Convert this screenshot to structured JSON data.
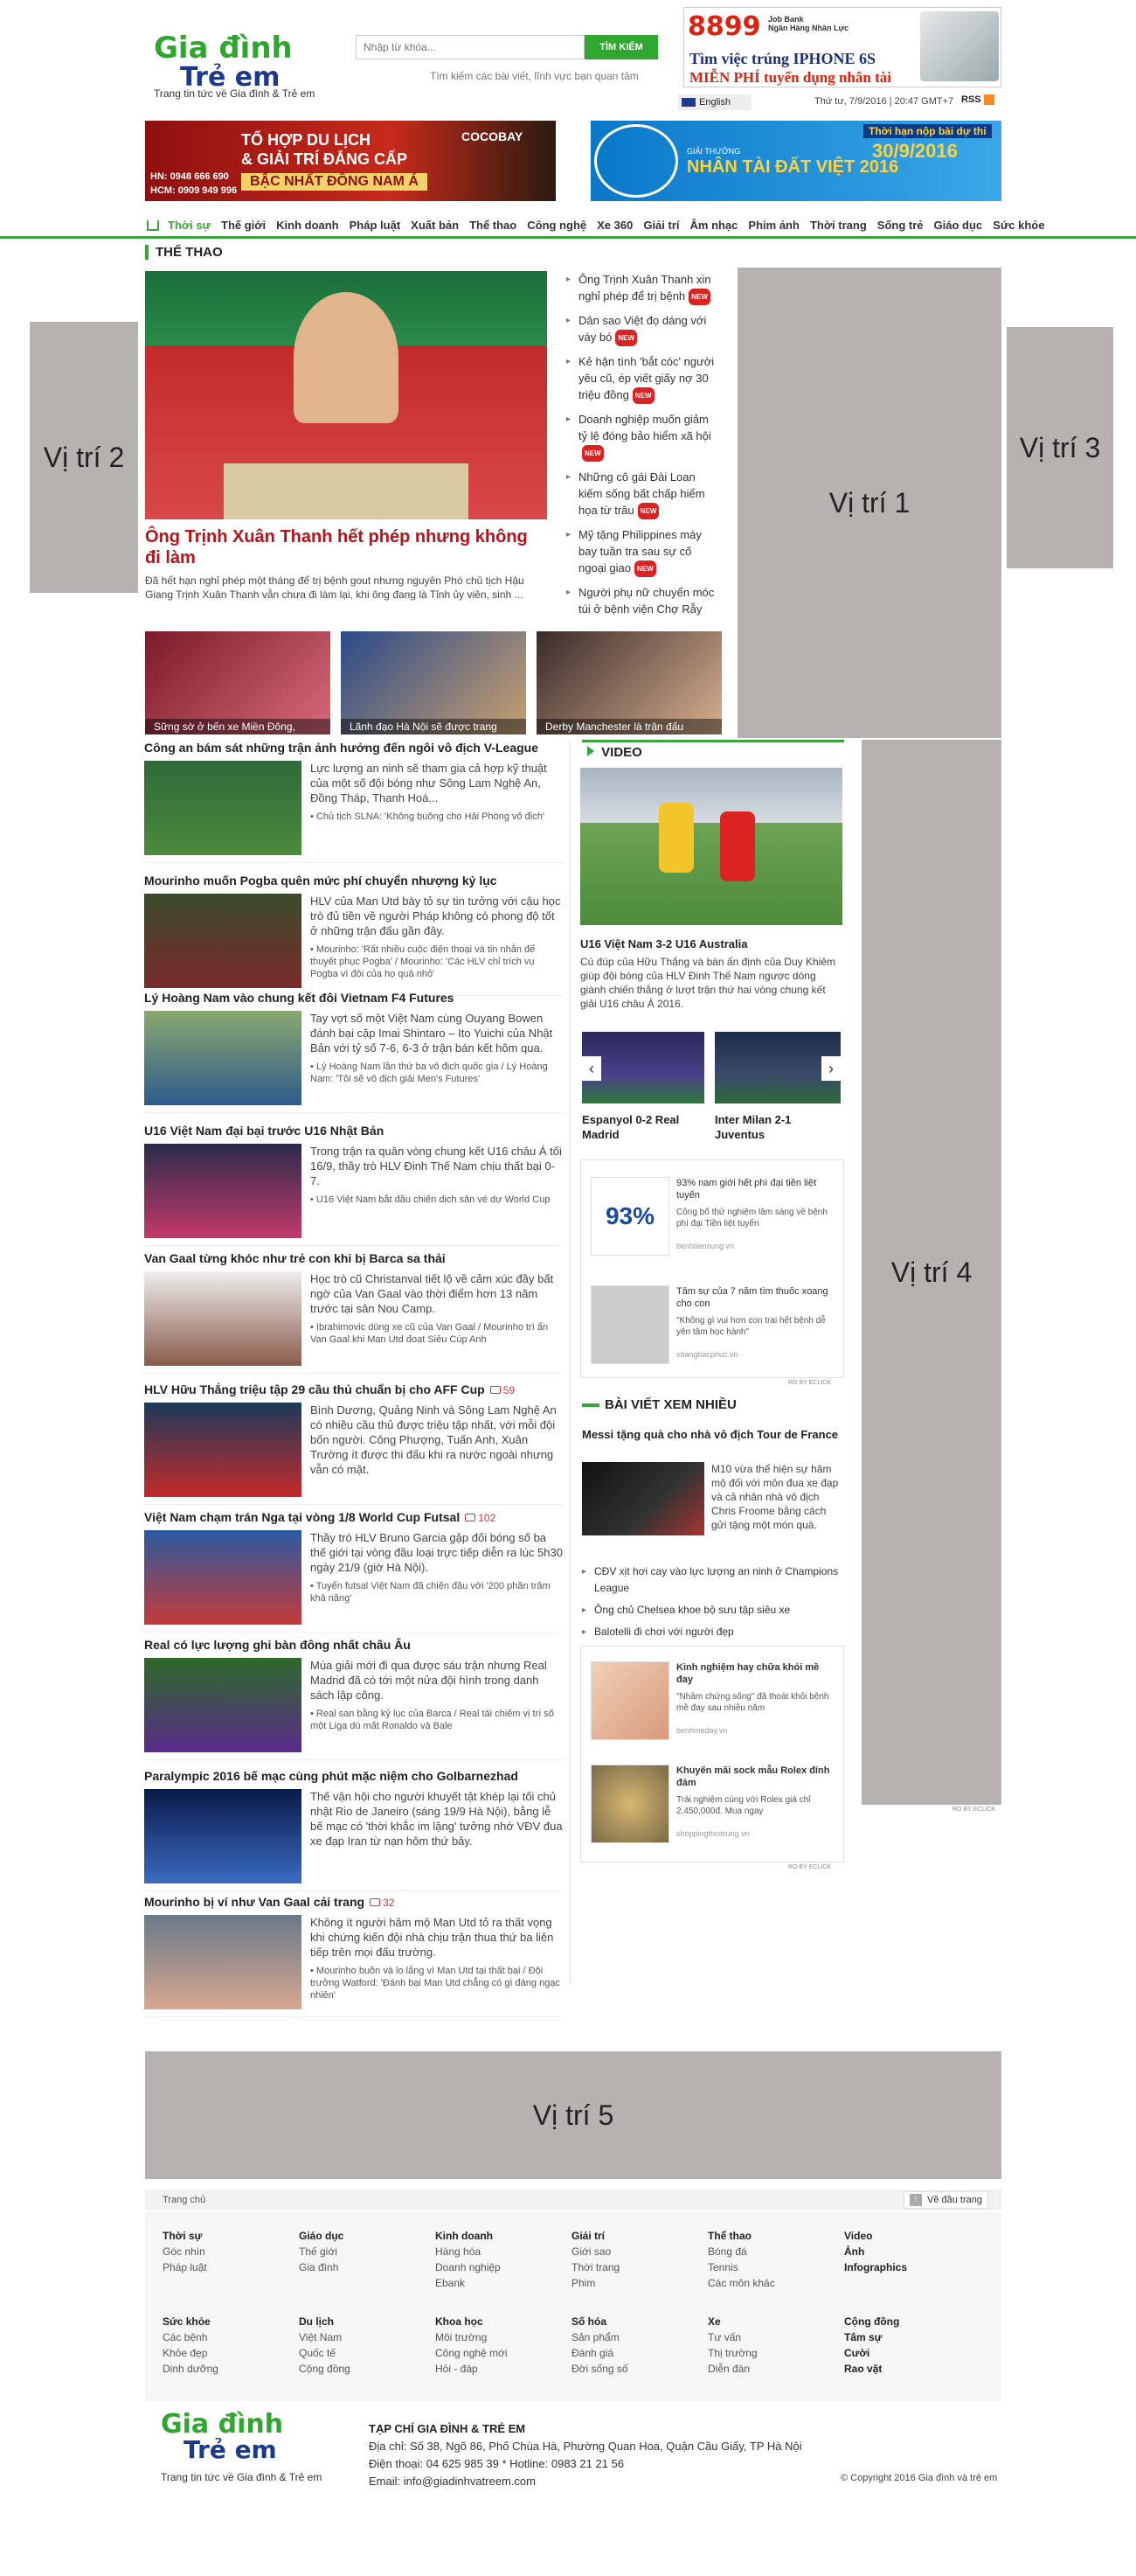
{
  "header": {
    "logo_line1": "Gia đình",
    "logo_line2": "Trẻ em",
    "tagline": "Trang tin tức về Gia đình & Trẻ em",
    "search_placeholder": "Nhập từ khóa...",
    "search_button": "TÌM KIẾM",
    "search_hint": "Tìm kiếm các bài viết, lĩnh vực bạn quan tâm",
    "lang": "English",
    "datetime": "Thứ tư, 7/9/2016 | 20:47 GMT+7",
    "rss": "RSS"
  },
  "banners": {
    "top_ad_num": "8899",
    "top_ad_bank": "Job Bank\nNgân Hàng Nhân Lực",
    "top_ad_line1": "Tìm việc trúng IPHONE 6S",
    "top_ad_line2": "MIỄN PHÍ tuyển dụng nhân tài",
    "left_ad_l1": "TỔ HỢP DU LỊCH",
    "left_ad_l2": "& GIẢI TRÍ ĐẲNG CẤP",
    "left_ad_l3": "BẬC NHẤT ĐÔNG NAM Á",
    "left_ad_hn": "HN: 0948 666 690",
    "left_ad_hcm": "HCM: 0909 949 996",
    "left_ad_brand": "COCOBAY",
    "right_ad_l1": "Thời hạn nộp bài dự thi",
    "right_ad_date": "30/9/2016",
    "right_ad_title": "NHÂN TÀI ĐẤT VIỆT 2016",
    "right_ad_sub": "GIẢI THƯỞNG"
  },
  "nav": [
    "Thời sự",
    "Thế giới",
    "Kinh doanh",
    "Pháp luật",
    "Xuất bản",
    "Thể thao",
    "Công nghệ",
    "Xe 360",
    "Giải trí",
    "Âm nhạc",
    "Phim ảnh",
    "Thời trang",
    "Sống trẻ",
    "Giáo dục",
    "Sức khỏe"
  ],
  "placeholders": {
    "vt1": "Vị trí 1",
    "vt2": "Vị trí 2",
    "vt3": "Vị trí 3",
    "vt4": "Vị trí 4",
    "vt5": "Vị trí 5"
  },
  "section": "THỂ THAO",
  "lead": {
    "title": "Ông Trịnh Xuân Thanh hết phép nhưng không đi làm",
    "summary": "Đã hết hạn nghỉ phép một tháng để trị bệnh gout nhưng nguyên Phó chủ tịch Hậu Giang Trịnh Xuân Thanh vẫn chưa đi làm lại, khi ông đang là Tỉnh ủy viên, sinh ..."
  },
  "side_list": [
    "Ông Trịnh Xuân Thanh xin nghỉ phép để trị bệnh",
    "Dân sao Việt đọ dáng với váy bó",
    "Kẻ hận tình 'bắt cóc' người yêu cũ, ép viết giấy nợ 30 triệu đồng",
    "Doanh nghiệp muốn giảm tỷ lệ đóng bảo hiểm xã hội",
    "Những cô gái Đài Loan kiếm sống bất chấp hiểm họa từ trâu",
    "Mỹ tặng Philippines máy bay tuần tra sau sự cố ngoại giao",
    "Người phụ nữ chuyển móc túi ở bệnh viện Chợ Rẫy"
  ],
  "photo_strip": [
    "Sững sờ ở bến xe Miền Đông,",
    "Lãnh đạo Hà Nội sẽ được trang",
    "Derby Manchester là trận đấu"
  ],
  "news": [
    {
      "title": "Công an bám sát những trận ảnh hưởng đến ngôi vô địch V-League",
      "summary": "Lực lượng an ninh sẽ tham gia cả hợp kỹ thuật của một số đội bóng như Sông Lam Nghệ An, Đồng Tháp, Thanh Hoá...",
      "rel": "• Chủ tịch SLNA: 'Không buông cho Hải Phòng vô địch'",
      "cmt": ""
    },
    {
      "title": "Mourinho muốn Pogba quên mức phí chuyển nhượng kỷ lục",
      "summary": "HLV của Man Utd bày tỏ sự tin tưởng với cậu học trò đủ tiền về người Pháp không có phong độ tốt ở những trận đấu gần đây.",
      "rel": "• Mourinho: 'Rất nhiều cuộc điện thoại và tin nhắn để thuyết phục Pogba' / Mourinho: 'Các HLV chỉ trích vụ Pogba vì đội của họ quá nhỏ'",
      "cmt": ""
    },
    {
      "title": "Lý Hoàng Nam vào chung kết đôi Vietnam F4 Futures",
      "summary": "Tay vợt số một Việt Nam cùng Ouyang Bowen đánh bại cặp Imai Shintaro – Ito Yuichi của Nhật Bản với tỷ số 7-6, 6-3 ở trận bán kết hôm qua.",
      "rel": "• Lý Hoàng Nam lần thứ ba vô địch quốc gia / Lý Hoàng Nam: 'Tôi sẽ vô địch giải Men's Futures'",
      "cmt": ""
    },
    {
      "title": "U16 Việt Nam đại bại trước U16 Nhật Bản",
      "summary": "Trong trận ra quân vòng chung kết U16 châu Á tối 16/9, thầy trò HLV Đinh Thế Nam chịu thất bại 0-7.",
      "rel": "• U16 Việt Nam bắt đầu chiến dịch săn vé dự World Cup",
      "cmt": ""
    },
    {
      "title": "Van Gaal từng khóc như trẻ con khi bị Barca sa thải",
      "summary": "Học trò cũ Christanval tiết lộ về cảm xúc đầy bất ngờ của Van Gaal vào thời điểm hơn 13 năm trước tại sân Nou Camp.",
      "rel": "• Ibrahimovic dùng xe cũ của Van Gaal / Mourinho trì ẩn Van Gaal khi Man Utd đoạt Siêu Cúp Anh",
      "cmt": ""
    },
    {
      "title": "HLV Hữu Thắng triệu tập 29 cầu thủ chuẩn bị cho AFF Cup",
      "summary": "Bình Dương, Quảng Ninh và Sông Lam Nghệ An có nhiều cầu thủ được triệu tập nhất, với mỗi đội bốn người. Công Phượng, Tuấn Anh, Xuân Trường ít được thi đấu khi ra nước ngoài nhưng vẫn có mặt.",
      "rel": "",
      "cmt": "59"
    },
    {
      "title": "Việt Nam chạm trán Nga tại vòng 1/8 World Cup Futsal",
      "summary": "Thầy trò HLV Bruno Garcia gặp đối bóng số ba thế giới tại vòng đầu loại trực tiếp diễn ra lúc 5h30 ngày 21/9 (giờ Hà Nội).",
      "rel": "• Tuyển futsal Việt Nam đã chiến đầu với '200 phần trăm khả năng'",
      "cmt": "102"
    },
    {
      "title": "Real có lực lượng ghi bàn đông nhất châu Âu",
      "summary": "Mùa giải mới đi qua được sáu trận nhưng Real Madrid đã có tới một nửa đội hình trong danh sách lập công.",
      "rel": "• Real san bằng kỷ lục của Barca / Real tái chiếm vị trí số một Liga dù mất Ronaldo và Bale",
      "cmt": ""
    },
    {
      "title": "Paralympic 2016 bế mạc cùng phút mặc niệm cho Golbarnezhad",
      "summary": "Thế vận hội cho người khuyết tật khép lại tối chủ nhật Rio de Janeiro (sáng 19/9 Hà Nội), bằng lễ bế mạc có 'thời khắc im lặng' tưởng nhớ VĐV đua xe đạp Iran từ nạn hôm thứ bảy.",
      "rel": "",
      "cmt": ""
    },
    {
      "title": "Mourinho bị ví như Van Gaal cải trang",
      "summary": "Không ít người hâm mộ Man Utd tỏ ra thất vọng khi chứng kiến đội nhà chịu trận thua thứ ba liên tiếp trên mọi đấu trường.",
      "rel": "• Mourinho buồn và lo lắng vì Man Utd tại thất bại / Đội trưởng Watford: 'Đánh bại Man Utd chẳng có gì đáng ngạc nhiên'",
      "cmt": "32"
    }
  ],
  "video": {
    "header": "VIDEO",
    "title": "U16 Việt Nam 3-2 U16 Australia",
    "summary": "Cú đúp của Hữu Thắng và bàn ấn định của Duy Khiêm giúp đội bóng của HLV Đinh Thế Nam ngược dòng giành chiến thắng ở lượt trận thứ hai vòng chung kết giải U16 châu Á 2016.",
    "t1": "Espanyol 0-2 Real Madrid",
    "t2": "Inter Milan 2-1 Juventus"
  },
  "ads1": [
    {
      "t": "93% nam giới hết phì đại tiền liệt tuyến",
      "d": "Công bố thử nghiệm lâm sàng về bệnh phì đại Tiền liệt tuyến",
      "u": "benhtiensung.vn",
      "img": "93%"
    },
    {
      "t": "Tâm sự của 7 năm tìm thuốc xoang cho con",
      "d": "\"Không gì vui hơn con trai hết bệnh dễ yên tâm học hành\"",
      "u": "xoangbacphuc.vn",
      "img": ""
    }
  ],
  "most_read": {
    "header": "BÀI VIẾT XEM NHIỀU",
    "title": "Messi tặng quà cho nhà vô địch Tour de France",
    "summary": "M10 vừa thể hiện sự hâm mộ đối với môn đua xe đạp và cả nhân nhà vô địch Chris Froome bằng cách gửi tặng một món quà.",
    "list": [
      "CĐV xịt hơi cay vào lực lượng an ninh ở Champions League",
      "Ông chủ Chelsea khoe bộ sưu tập siêu xe",
      "Balotelli đi chơi với người đẹp"
    ]
  },
  "ads2": [
    {
      "t": "Kinh nghiệm hay chữa khỏi mề đay",
      "d": "\"Nhầm chứng sống\" đã thoát khỏi bệnh mề đay sau nhiều năm",
      "u": "benhmeday.vn"
    },
    {
      "t": "Khuyến mãi sock mẫu Rolex đính đám",
      "d": "Trải nghiệm cùng với Rolex giá chỉ 2,450,000đ. Mua ngay",
      "u": "shoppingthoitrung.vn"
    }
  ],
  "adlabel": "RO BY ECLICK",
  "footer": {
    "home": "Trang chủ",
    "top": "Về đầu trang",
    "cols": [
      {
        "h1": "Thời sự",
        "items1": [
          "Góc nhìn",
          "Pháp luật"
        ],
        "h2": "Sức khỏe",
        "items2": [
          "Các bệnh",
          "Khỏe đẹp",
          "Dinh dưỡng"
        ]
      },
      {
        "h1": "Giáo dục",
        "items1": [
          "Thế giới",
          "Gia đình"
        ],
        "h2": "Du lịch",
        "items2": [
          "Việt Nam",
          "Quốc tế",
          "Cộng đồng"
        ]
      },
      {
        "h1": "Kinh doanh",
        "items1": [
          "Hàng hóa",
          "Doanh nghiệp",
          "Ebank"
        ],
        "h2": "Khoa học",
        "items2": [
          "Môi trường",
          "Công nghệ mới",
          "Hỏi - đáp"
        ]
      },
      {
        "h1": "Giải trí",
        "items1": [
          "Giới sao",
          "Thời trang",
          "Phim"
        ],
        "h2": "Số hóa",
        "items2": [
          "Sản phẩm",
          "Đánh giá",
          "Đời sống số"
        ]
      },
      {
        "h1": "Thể thao",
        "items1": [
          "Bóng đá",
          "Tennis",
          "Các môn khác"
        ],
        "h2": "Xe",
        "items2": [
          "Tư vấn",
          "Thị trường",
          "Diễn đàn"
        ]
      },
      {
        "h1": "Video",
        "items1": [
          "Ảnh",
          "Infographics"
        ],
        "h2": "Cộng đồng",
        "items2": [
          "Tâm sự",
          "Cười",
          "Rao vặt"
        ]
      }
    ],
    "org": "TẠP CHÍ GIA ĐÌNH & TRẺ EM",
    "addr": "Địa chỉ: Số 38, Ngõ 86, Phố Chùa Hà, Phường Quan Hoa, Quận Cầu Giấy, TP Hà Nội",
    "phone": "Điện thoại: 04 625 985 39 * Hotline: 0983 21 21 56",
    "email": "Email: info@giadinhvatreem.com",
    "copy": "© Copyright 2016 Gia đình và trẻ em"
  }
}
